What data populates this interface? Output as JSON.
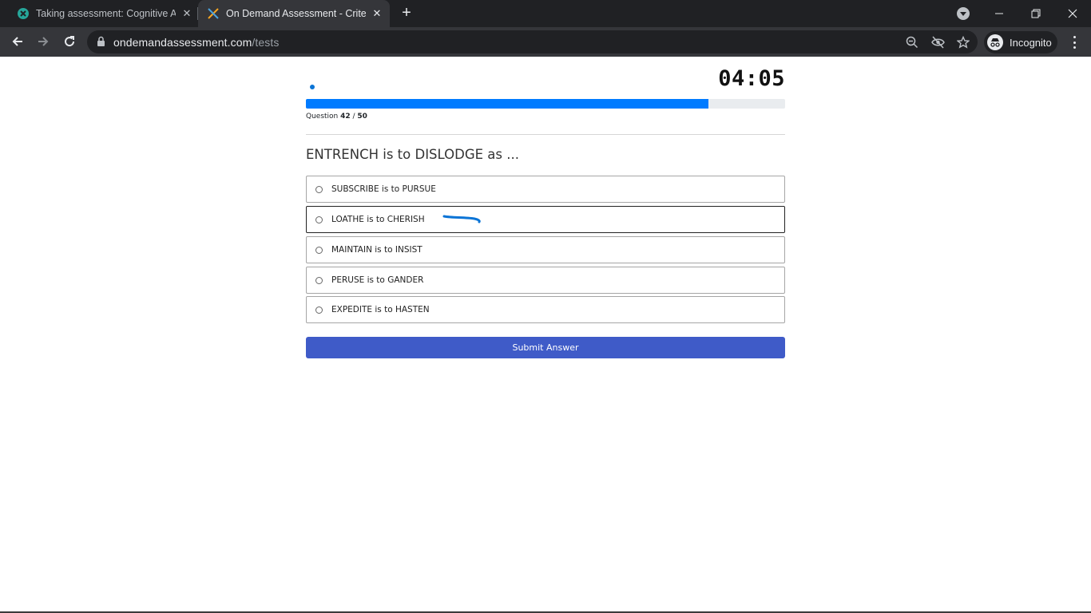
{
  "browser": {
    "tabs": [
      {
        "title": "Taking assessment: Cognitive Apt",
        "icon": "x-circle-favicon-icon",
        "active": false
      },
      {
        "title": "On Demand Assessment - Criteria",
        "icon": "criteria-favicon-icon",
        "active": true
      }
    ],
    "url_host": "ondemandassessment.com",
    "url_path": "/tests",
    "profile_label": "Incognito"
  },
  "assessment": {
    "timer": "04:05",
    "progress_fraction": 0.84,
    "question_prefix": "Question ",
    "question_current": "42",
    "question_separator": " / ",
    "question_total": "50",
    "question_text": "ENTRENCH is to DISLODGE as ...",
    "options": [
      {
        "label": "SUBSCRIBE is to PURSUE"
      },
      {
        "label": "LOATHE is to CHERISH"
      },
      {
        "label": "MAINTAIN is to INSIST"
      },
      {
        "label": "PERUSE is to GANDER"
      },
      {
        "label": "EXPEDITE is to HASTEN"
      }
    ],
    "submit_label": "Submit Answer"
  },
  "colors": {
    "progress_fill": "#007bff",
    "submit_bg": "#3f5bc8",
    "annotation_stroke": "#0b74d6"
  }
}
